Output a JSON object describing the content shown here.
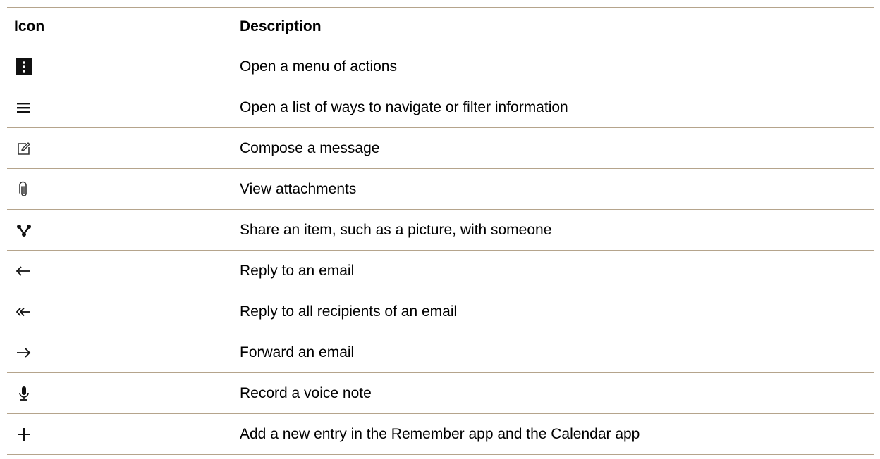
{
  "table": {
    "headers": {
      "icon": "Icon",
      "description": "Description"
    },
    "rows": [
      {
        "icon": "more-vertical-icon",
        "description": "Open a menu of actions"
      },
      {
        "icon": "hamburger-menu-icon",
        "description": "Open a list of ways to navigate or filter information"
      },
      {
        "icon": "compose-icon",
        "description": "Compose a message"
      },
      {
        "icon": "paperclip-icon",
        "description": "View attachments"
      },
      {
        "icon": "share-icon",
        "description": "Share an item, such as a picture, with someone"
      },
      {
        "icon": "reply-arrow-icon",
        "description": "Reply to an email"
      },
      {
        "icon": "reply-all-arrow-icon",
        "description": "Reply to all recipients of an email"
      },
      {
        "icon": "forward-arrow-icon",
        "description": "Forward an email"
      },
      {
        "icon": "microphone-icon",
        "description": "Record a voice note"
      },
      {
        "icon": "plus-icon",
        "description": "Add a new entry in the Remember app and the Calendar app"
      }
    ]
  }
}
